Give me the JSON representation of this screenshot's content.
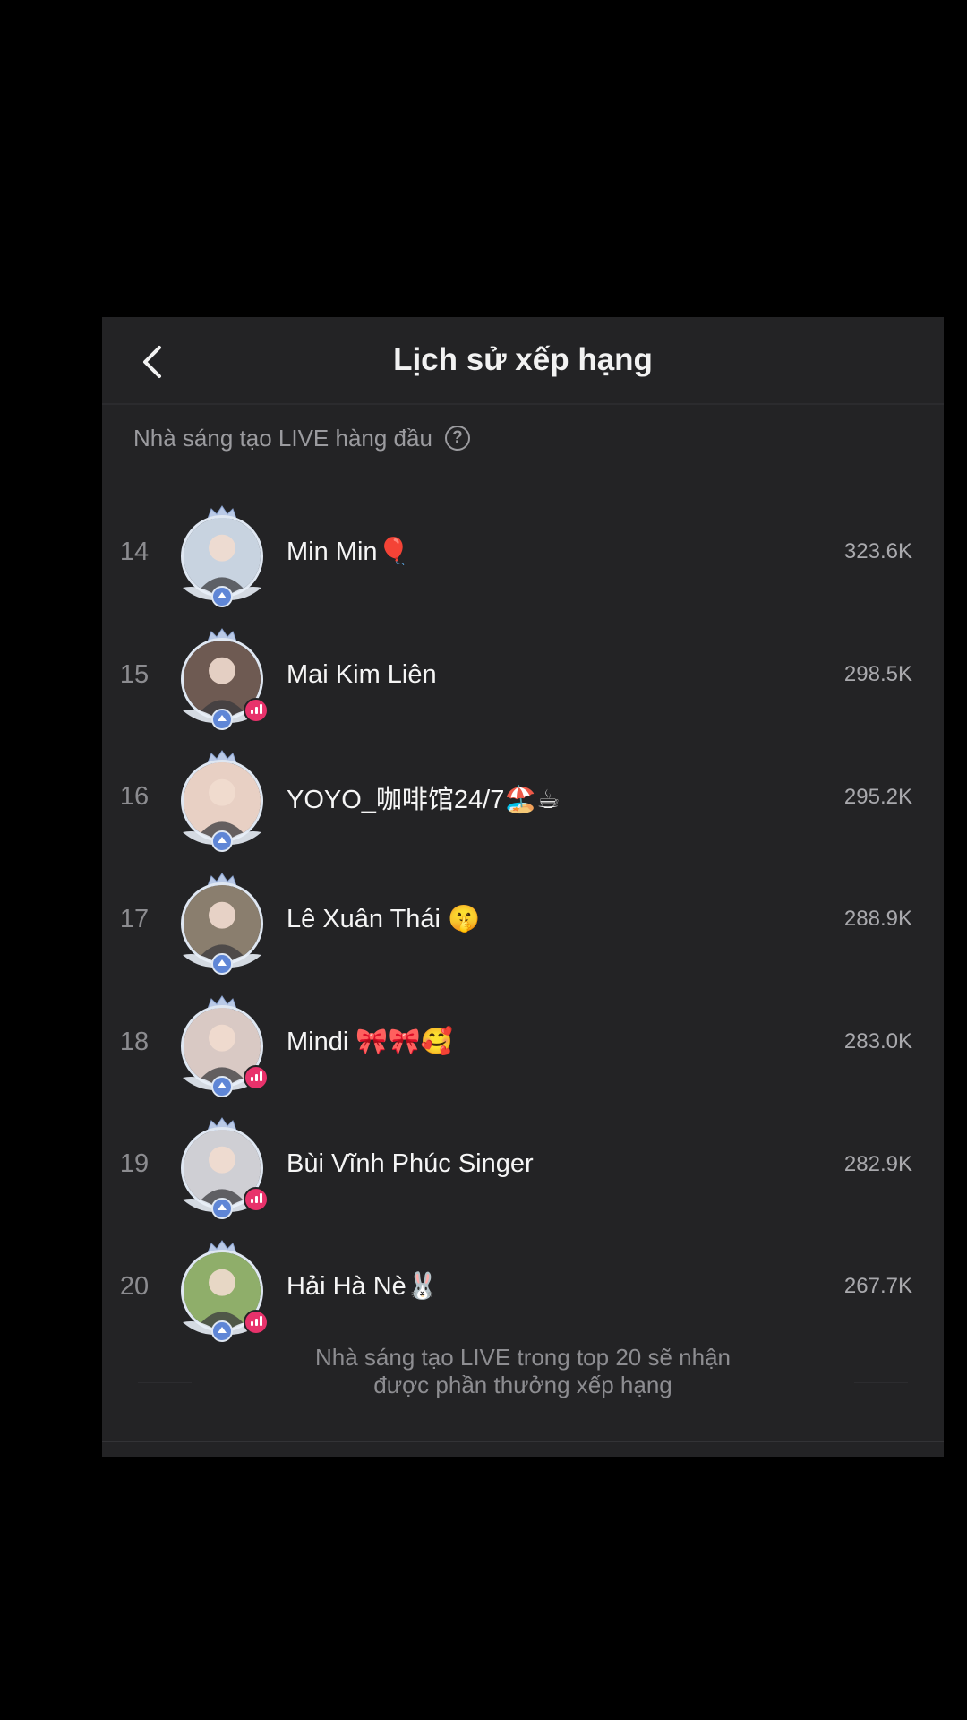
{
  "header": {
    "title": "Lịch sử xếp hạng",
    "back_icon": "chevron-left-icon"
  },
  "section": {
    "label": "Nhà sáng tạo LIVE hàng đầu",
    "help_icon": "?"
  },
  "rankings": [
    {
      "rank": "14",
      "name": "Min Min🎈",
      "score": "323.6K",
      "live": false,
      "avatar_color": "#c8d3e0"
    },
    {
      "rank": "15",
      "name": "Mai Kim Liên",
      "score": "298.5K",
      "live": true,
      "avatar_color": "#6e5a52"
    },
    {
      "rank": "16",
      "name": "YOYO_咖啡馆24/7🏖️☕",
      "score": "295.2K",
      "live": false,
      "avatar_color": "#e8d0c4"
    },
    {
      "rank": "17",
      "name": "Lê Xuân Thái 🤫",
      "score": "288.9K",
      "live": false,
      "avatar_color": "#8a7e6e"
    },
    {
      "rank": "18",
      "name": "Mindi 🎀🎀🥰",
      "score": "283.0K",
      "live": true,
      "avatar_color": "#d9c9c4"
    },
    {
      "rank": "19",
      "name": "Bùi Vĩnh Phúc Singer",
      "score": "282.9K",
      "live": true,
      "avatar_color": "#cfcfd4"
    },
    {
      "rank": "20",
      "name": "Hải Hà Nè🐰",
      "score": "267.7K",
      "live": true,
      "avatar_color": "#8fae6a"
    }
  ],
  "footer": {
    "note": "Nhà sáng tạo LIVE trong top 20 sẽ nhận được phần thưởng xếp hạng"
  },
  "colors": {
    "background": "#000000",
    "panel": "#232325",
    "live_badge": "#e8326b",
    "frame": "#dfe7f2"
  }
}
